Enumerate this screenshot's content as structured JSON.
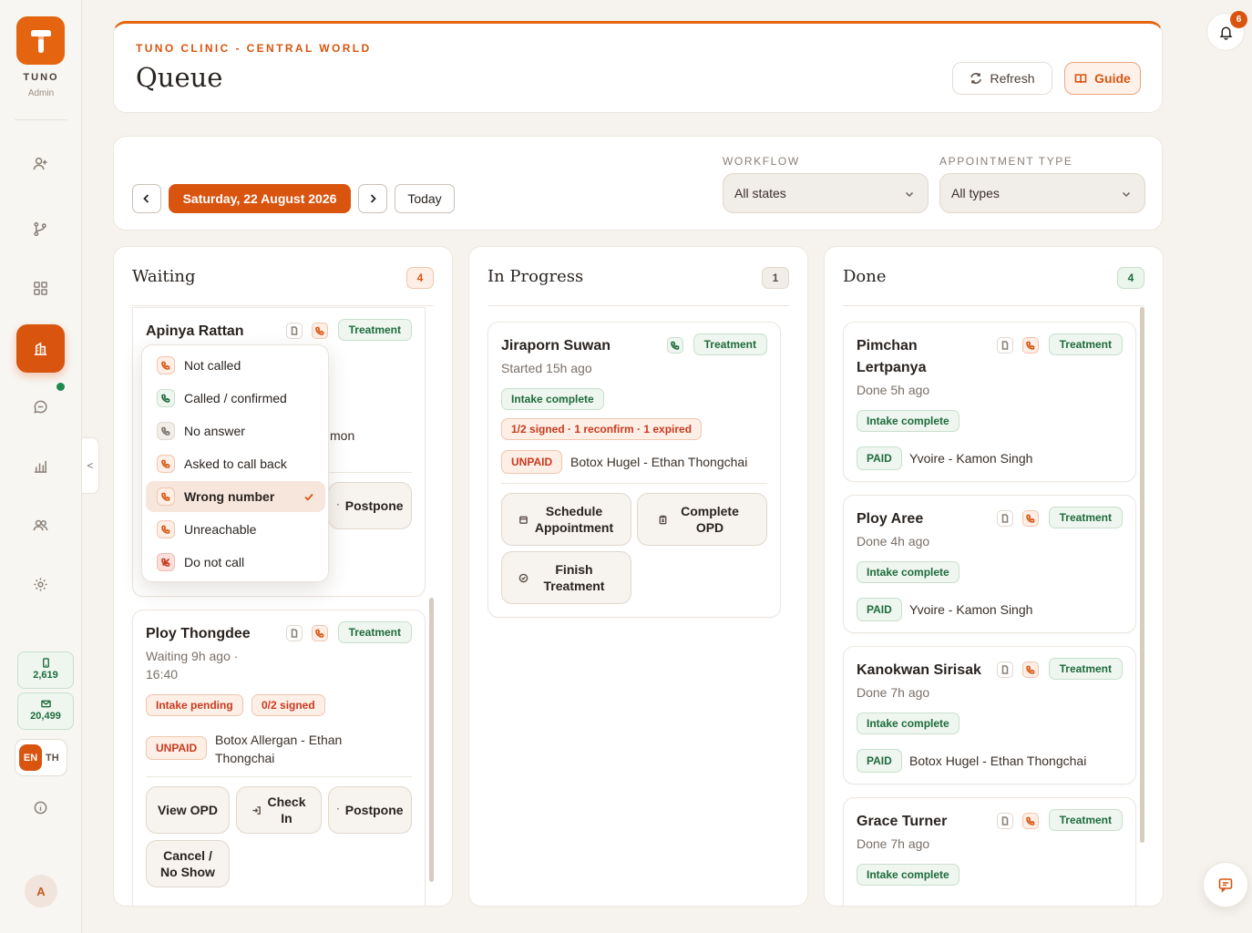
{
  "sidebar": {
    "brand": "TUNO",
    "role": "Admin",
    "credits": [
      {
        "icon": "phone-icon",
        "value": "2,619"
      },
      {
        "icon": "mail-icon",
        "value": "20,499"
      }
    ],
    "lang": {
      "active": "EN",
      "other": "TH"
    },
    "avatar_initial": "A",
    "collapse_glyph": "<"
  },
  "header": {
    "clinic": "TUNO CLINIC - CENTRAL WORLD",
    "title": "Queue",
    "refresh_label": "Refresh",
    "guide_label": "Guide"
  },
  "filters": {
    "date": "Saturday, 22 August 2026",
    "today_label": "Today",
    "workflow_label": "WORKFLOW",
    "workflow_value": "All states",
    "appt_label": "APPOINTMENT TYPE",
    "appt_value": "All types"
  },
  "columns": {
    "waiting": {
      "title": "Waiting",
      "count": "4",
      "cards": [
        {
          "name": "Apinya Rattan",
          "tag": "Treatment",
          "partial_text": "mon",
          "actions": {
            "postpone": "Postpone"
          }
        },
        {
          "name": "Ploy Thongdee",
          "tag": "Treatment",
          "sub1": "Waiting 9h ago ·",
          "sub2": "16:40",
          "badges": [
            "Intake pending",
            "0/2 signed"
          ],
          "payment": "UNPAID",
          "service_line1": "Botox Allergan - Ethan",
          "service_line2": "Thongchai",
          "actions": {
            "view_opd": "View OPD",
            "check_in_1": "Check",
            "check_in_2": "In",
            "postpone": "Postpone",
            "cancel_1": "Cancel /",
            "cancel_2": "No Show"
          }
        }
      ]
    },
    "in_progress": {
      "title": "In Progress",
      "count": "1",
      "cards": [
        {
          "name": "Jiraporn Suwan",
          "tag": "Treatment",
          "sub": "Started 15h ago",
          "badges": [
            "Intake complete",
            "1/2 signed · 1 reconfirm · 1 expired"
          ],
          "payment": "UNPAID",
          "service": "Botox Hugel - Ethan Thongchai",
          "actions": {
            "schedule_1": "Schedule",
            "schedule_2": "Appointment",
            "complete_1": "Complete",
            "complete_2": "OPD",
            "finish_1": "Finish",
            "finish_2": "Treatment"
          }
        }
      ]
    },
    "done": {
      "title": "Done",
      "count": "4",
      "cards": [
        {
          "name_1": "Pimchan",
          "name_2": "Lertpanya",
          "tag": "Treatment",
          "sub": "Done 5h ago",
          "badge": "Intake complete",
          "payment": "PAID",
          "service": "Yvoire - Kamon Singh"
        },
        {
          "name": "Ploy Aree",
          "tag": "Treatment",
          "sub": "Done 4h ago",
          "badge": "Intake complete",
          "payment": "PAID",
          "service": "Yvoire - Kamon Singh"
        },
        {
          "name": "Kanokwan Sirisak",
          "tag": "Treatment",
          "sub": "Done 7h ago",
          "badge": "Intake complete",
          "payment": "PAID",
          "service": "Botox Hugel - Ethan Thongchai"
        },
        {
          "name": "Grace Turner",
          "tag": "Treatment",
          "sub": "Done 7h ago",
          "badge": "Intake complete"
        }
      ]
    }
  },
  "call_status_dropdown": {
    "selected": "Wrong number",
    "options": [
      "Not called",
      "Called / confirmed",
      "No answer",
      "Asked to call back",
      "Wrong number",
      "Unreachable",
      "Do not call"
    ]
  },
  "notifications": {
    "count": "6"
  },
  "colors": {
    "accent": "#d9540f",
    "success": "#1f6b3c",
    "danger": "#c93a1e"
  }
}
